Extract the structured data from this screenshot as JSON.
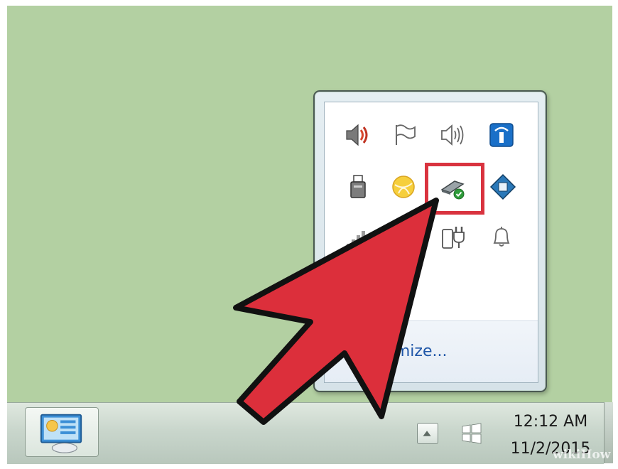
{
  "tray_popup": {
    "customize_link": "Customize...",
    "icons": [
      {
        "name": "speaker-muted-icon"
      },
      {
        "name": "action-center-flag-icon"
      },
      {
        "name": "volume-icon"
      },
      {
        "name": "intel-wireless-icon"
      },
      {
        "name": "usb-device-icon"
      },
      {
        "name": "yellow-ball-app-icon"
      },
      {
        "name": "safely-remove-hardware-icon"
      },
      {
        "name": "blue-diamond-app-icon"
      },
      {
        "name": "network-signal-icon"
      },
      {
        "name": "unknown-icon"
      },
      {
        "name": "power-plug-icon"
      },
      {
        "name": "notification-bell-icon"
      }
    ],
    "highlighted_icon": "safely-remove-hardware-icon"
  },
  "taskbar": {
    "pinned_app": "control-panel-icon",
    "clock": {
      "time": "12:12 AM",
      "date": "11/2/2015"
    }
  },
  "colors": {
    "desktop": "#b3d0a2",
    "highlight": "#d9333f",
    "arrow": "#dc2f3b",
    "link": "#1f56a8"
  },
  "watermark": "wikiHow"
}
